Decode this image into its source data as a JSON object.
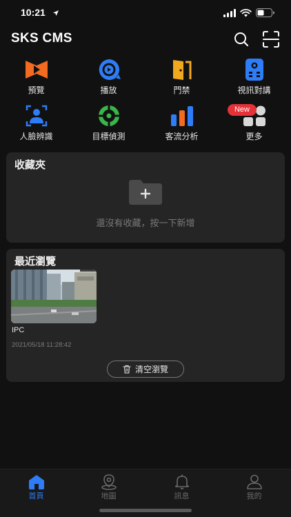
{
  "status_bar": {
    "time": "10:21"
  },
  "app": {
    "title": "SKS CMS"
  },
  "features": [
    {
      "label": "預覽"
    },
    {
      "label": "播放"
    },
    {
      "label": "門禁"
    },
    {
      "label": "視訊對講"
    },
    {
      "label": "人臉辨識"
    },
    {
      "label": "目標偵測"
    },
    {
      "label": "客流分析"
    },
    {
      "label": "更多",
      "badge": "New"
    }
  ],
  "favorites": {
    "title": "收藏夾",
    "empty_text": "還沒有收藏，按一下新增"
  },
  "recent": {
    "title": "最近瀏覽",
    "items": [
      {
        "name": "IPC",
        "time": "2021/05/18 11:28:42"
      }
    ],
    "clear_label": "清空瀏覽"
  },
  "tabs": [
    {
      "label": "首頁",
      "active": true
    },
    {
      "label": "地圖"
    },
    {
      "label": "訊息"
    },
    {
      "label": "我的"
    }
  ],
  "colors": {
    "accent": "#2f7df6",
    "orange": "#f26b21",
    "badge": "#e53238",
    "background": "#111111",
    "card": "#252525"
  }
}
